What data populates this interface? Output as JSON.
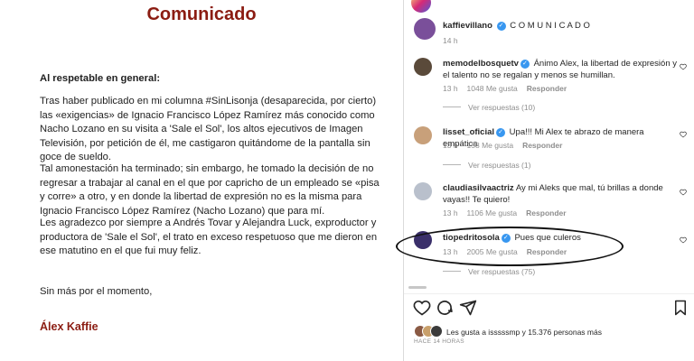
{
  "document": {
    "title": "Comunicado",
    "greeting": "Al respetable en general:",
    "paragraphs": [
      "Tras haber publicado en mi columna #SinLisonja (desaparecida, por cierto) las «exigencias» de Ignacio Francisco López Ramírez más conocido como Nacho Lozano en su visita a 'Sale el Sol', los altos ejecutivos de Imagen Televisión, por petición de él, me castigaron quitándome de la pantalla sin goce de sueldo.",
      "Tal amonestación ha terminado; sin embargo, he tomado la decisión de no regresar a trabajar al canal en el que por capricho de un empleado se «pisa y corre» a otro, y en donde la libertad de expresión no es la misma para Ignacio Francisco López Ramírez (Nacho Lozano) que para mí.",
      "Les agradezco por siempre a Andrés Tovar y Alejandra Luck, exproductor y productora de 'Sale el Sol', el trato en exceso respetuoso que me dieron en ese matutino en el que fui muy feliz.",
      "Sin más por el momento,"
    ],
    "signature": "Álex Kaffie"
  },
  "post": {
    "author": "kaffievillano",
    "caption": "C O M U N I C A D O",
    "age": "14 h"
  },
  "comments": [
    {
      "user": "memodelbosquetv",
      "verified": true,
      "text": "Ánimo Alex, la libertad de expresión y el talento no se regalan y menos se humillan.",
      "age": "13 h",
      "likes": "1048 Me gusta",
      "reply": "Responder",
      "view_replies": "Ver respuestas (10)",
      "avatar_color": "#5a4a3a"
    },
    {
      "user": "lisset_oficial",
      "verified": true,
      "text": "Upa!!! Mi Alex te abrazo de manera empática",
      "age": "13 h",
      "likes": "158 Me gusta",
      "reply": "Responder",
      "view_replies": "Ver respuestas (1)",
      "avatar_color": "#c8a07a"
    },
    {
      "user": "claudiasilvaactriz",
      "verified": false,
      "text": "Ay mi Aleks que mal, tú brillas a donde vayas!! Te quiero!",
      "age": "13 h",
      "likes": "1106 Me gusta",
      "reply": "Responder",
      "view_replies": "Ver respuestas (2)",
      "avatar_color": "#b9c0cc"
    },
    {
      "user": "tiopedritosola",
      "verified": true,
      "text": "Pues que culeros",
      "age": "13 h",
      "likes": "2005 Me gusta",
      "reply": "Responder",
      "view_replies": "Ver respuestas (75)",
      "avatar_color": "#3a2f6a"
    }
  ],
  "footer": {
    "likes_text": "Les gusta a isssssmp y 15.376 personas más",
    "time_ago": "HACE 14 HORAS"
  }
}
